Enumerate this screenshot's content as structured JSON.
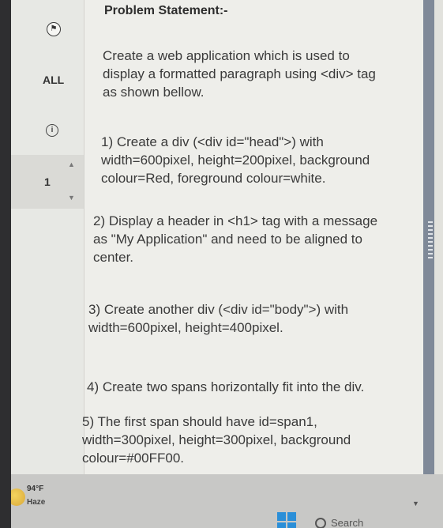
{
  "sidebar": {
    "all_label": "ALL",
    "question_number": "1"
  },
  "problem": {
    "title": "Problem Statement:-",
    "paragraphs": [
      [
        "Create a web application which is used to",
        "display a formatted paragraph using <div> tag",
        "as shown bellow."
      ],
      [
        "1) Create a div (<div id=\"head\">) with",
        "width=600pixel, height=200pixel, background",
        "colour=Red, foreground colour=white."
      ],
      [
        "2) Display a header in <h1> tag with a message",
        "as \"My Application\" and need to be aligned to",
        "center."
      ],
      [
        "3) Create another div (<div id=\"body\">) with",
        "width=600pixel, height=400pixel."
      ],
      [
        "4) Create two spans horizontally fit into the div."
      ],
      [
        "5) The first span should have id=span1,",
        "width=300pixel, height=300pixel,  background",
        "colour=#00FF00."
      ]
    ]
  },
  "taskbar": {
    "temperature": "94°F",
    "weather": "Haze",
    "search_label": "Search"
  },
  "icons": {
    "flag": "flag-icon",
    "info": "info-icon",
    "weather": "sun-haze-icon",
    "windows": "windows-icon",
    "search": "search-icon"
  }
}
